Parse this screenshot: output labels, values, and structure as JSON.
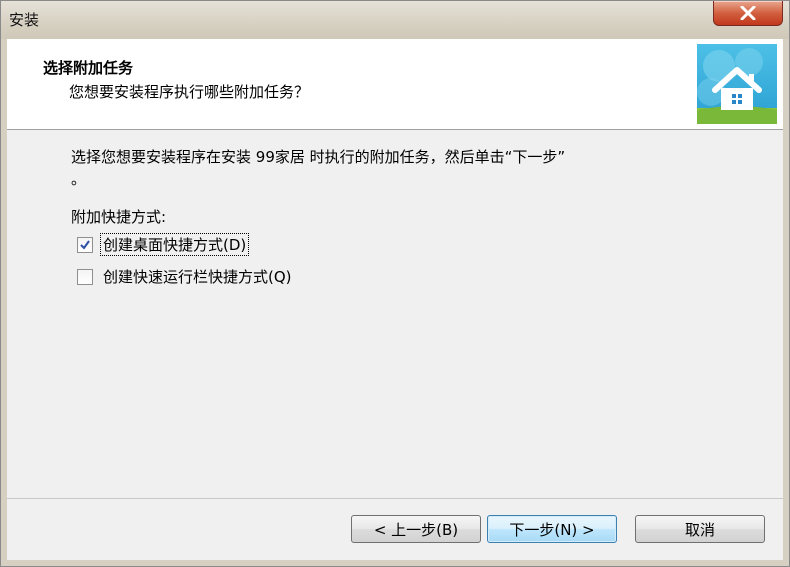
{
  "window": {
    "title": "安装",
    "close_icon": "close-icon"
  },
  "header": {
    "title": "选择附加任务",
    "subtitle": "您想要安装程序执行哪些附加任务？",
    "logo_icon": "house-logo-icon",
    "logo_colors": {
      "sky": "#3fb3de",
      "grass": "#8cc63f",
      "house": "#ffffff"
    }
  },
  "main": {
    "intro_line1": "选择您想要安装程序在安装 99家居 时执行的附加任务，然后单击“下一步”",
    "intro_line2": "。",
    "group_label": "附加快捷方式:",
    "options": [
      {
        "label": "创建桌面快捷方式(D)",
        "checked": true
      },
      {
        "label": "创建快速运行栏快捷方式(Q)",
        "checked": false
      }
    ]
  },
  "buttons": {
    "back": "< 上一步(B)",
    "next": "下一步(N) >",
    "cancel": "取消"
  }
}
